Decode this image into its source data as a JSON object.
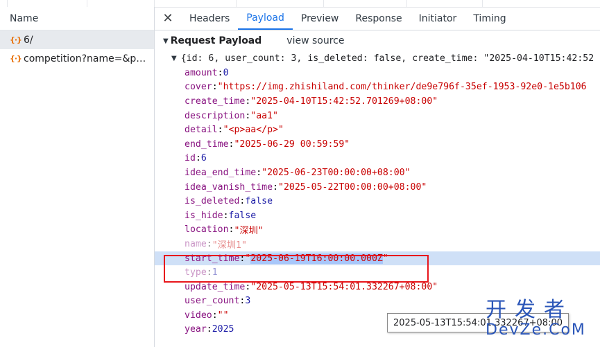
{
  "left_pane": {
    "column_header": "Name",
    "requests": [
      {
        "icon": "{·}",
        "name": "6/",
        "selected": true
      },
      {
        "icon": "{·}",
        "name": "competition?name=&pag...",
        "selected": false
      }
    ]
  },
  "tabs": {
    "close": "✕",
    "items": [
      "Headers",
      "Payload",
      "Preview",
      "Response",
      "Initiator",
      "Timing"
    ],
    "active": "Payload"
  },
  "payload": {
    "section_title": "Request Payload",
    "view_source": "view source",
    "summary": "{id: 6, user_count: 3, is_deleted: false, create_time: \"2025-04-10T15:42:52",
    "fields": [
      {
        "key": "amount",
        "value": "0",
        "kind": "number"
      },
      {
        "key": "cover",
        "value": "\"https://img.zhishiland.com/thinker/de9e796f-35ef-1953-92e0-1e5b106",
        "kind": "string"
      },
      {
        "key": "create_time",
        "value": "\"2025-04-10T15:42:52.701269+08:00\"",
        "kind": "string"
      },
      {
        "key": "description",
        "value": "\"aa1\"",
        "kind": "string"
      },
      {
        "key": "detail",
        "value": "\"<p>aa</p>\"",
        "kind": "string"
      },
      {
        "key": "end_time",
        "value": "\"2025-06-29 00:59:59\"",
        "kind": "string"
      },
      {
        "key": "id",
        "value": "6",
        "kind": "number"
      },
      {
        "key": "idea_end_time",
        "value": "\"2025-06-23T00:00:00+08:00\"",
        "kind": "string"
      },
      {
        "key": "idea_vanish_time",
        "value": "\"2025-05-22T00:00:00+08:00\"",
        "kind": "string"
      },
      {
        "key": "is_deleted",
        "value": "false",
        "kind": "bool"
      },
      {
        "key": "is_hide",
        "value": "false",
        "kind": "bool"
      },
      {
        "key": "location",
        "value": "\"深圳\"",
        "kind": "string"
      },
      {
        "key": "name",
        "value": "\"深圳1\"",
        "kind": "string"
      },
      {
        "key": "start_time",
        "value": "2025-06-19T16:00:00.000Z",
        "kind": "string",
        "highlighted": true
      },
      {
        "key": "type",
        "value": "1",
        "kind": "number"
      },
      {
        "key": "update_time",
        "value": "\"2025-05-13T15:54:01.332267+08:00\"",
        "kind": "string"
      },
      {
        "key": "user_count",
        "value": "3",
        "kind": "number"
      },
      {
        "key": "video",
        "value": "\"\"",
        "kind": "string"
      },
      {
        "key": "year",
        "value": "2025",
        "kind": "number"
      }
    ]
  },
  "tooltip": "2025-05-13T15:54:01.332267+08:00",
  "watermark": {
    "cn": "开发者",
    "en": "DevZe.CoM"
  },
  "colors": {
    "key": "#881280",
    "string": "#c80000",
    "number": "#1a1aa6",
    "accent": "#1a73e8",
    "highlight_box": "#e8151b"
  }
}
